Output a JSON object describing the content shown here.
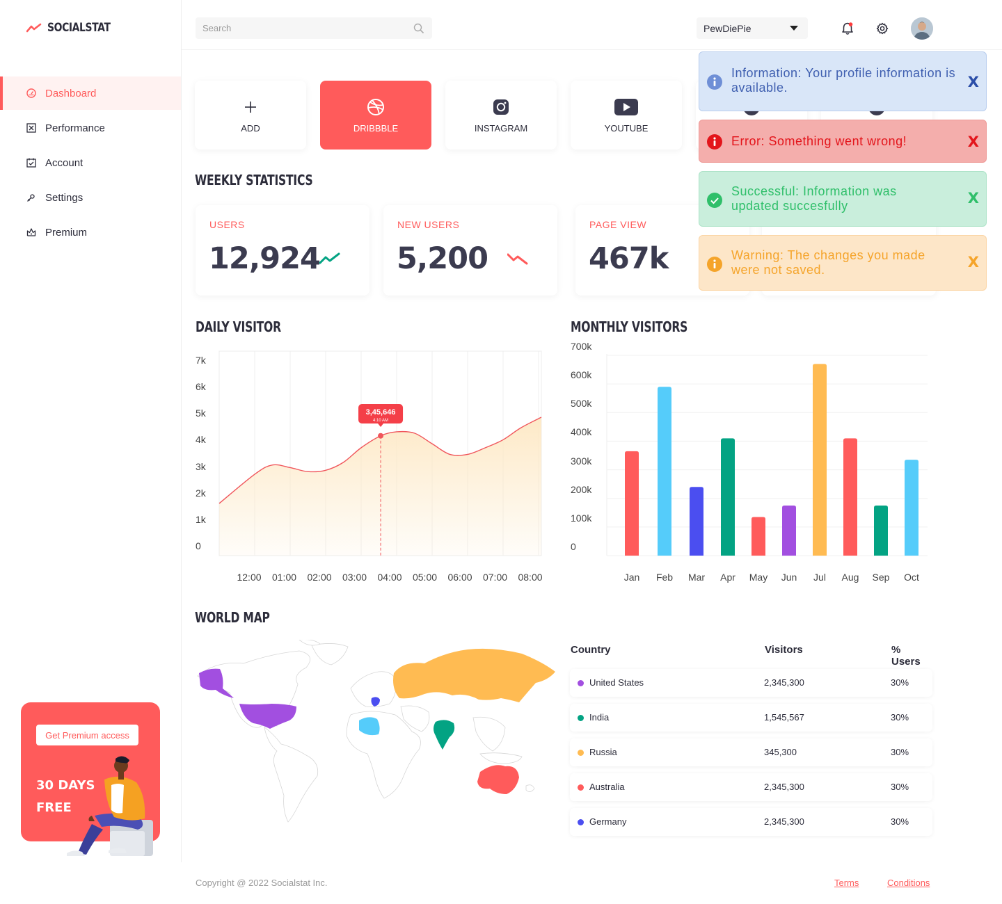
{
  "app": {
    "name": "SOCIALSTAT"
  },
  "sidebar": {
    "items": [
      {
        "label": "Dashboard",
        "icon": "dashboard-icon",
        "active": true
      },
      {
        "label": "Performance",
        "icon": "performance-icon"
      },
      {
        "label": "Account",
        "icon": "account-icon"
      },
      {
        "label": "Settings",
        "icon": "settings-icon"
      },
      {
        "label": "Premium",
        "icon": "premium-icon"
      }
    ],
    "premium": {
      "button_label": "Get Premium access",
      "title": "30 DAYS\nFREE"
    }
  },
  "header": {
    "search_placeholder": "Search",
    "account_selected": "PewDiePie"
  },
  "social": {
    "cards": [
      {
        "label": "ADD",
        "icon": "plus-icon"
      },
      {
        "label": "DRIBBBLE",
        "icon": "dribbble-icon",
        "active": true
      },
      {
        "label": "INSTAGRAM",
        "icon": "instagram-icon"
      },
      {
        "label": "YOUTUBE",
        "icon": "youtube-icon"
      }
    ]
  },
  "weekly": {
    "title": "WEEKLY STATISTICS",
    "stats": [
      {
        "label": "USERS",
        "value": "12,924",
        "trend": "up"
      },
      {
        "label": "NEW USERS",
        "value": "5,200",
        "trend": "down"
      },
      {
        "label": "PAGE VIEW",
        "value": "467k"
      }
    ]
  },
  "daily": {
    "title": "DAILY VISITOR",
    "tooltip": {
      "value": "3,45,646",
      "time": "4:10 AM"
    }
  },
  "monthly": {
    "title": "MONTHLY VISITORS"
  },
  "chart_data": [
    {
      "type": "area",
      "title": "DAILY VISITOR",
      "x": [
        "12:00",
        "01:00",
        "02:00",
        "03:00",
        "04:00",
        "05:00",
        "06:00",
        "07:00",
        "08:00"
      ],
      "y_ticks": [
        "0",
        "1k",
        "2k",
        "3k",
        "4k",
        "5k",
        "6k",
        "7k"
      ],
      "ylim": [
        0,
        7000
      ],
      "points": [
        {
          "t": -0.5,
          "v": 1600
        },
        {
          "t": 0,
          "v": 2700
        },
        {
          "t": 0.5,
          "v": 3050
        },
        {
          "t": 1,
          "v": 2950
        },
        {
          "t": 1.5,
          "v": 2800
        },
        {
          "t": 2,
          "v": 2850
        },
        {
          "t": 2.5,
          "v": 3150
        },
        {
          "t": 3,
          "v": 3700
        },
        {
          "t": 3.55,
          "v": 4150
        },
        {
          "t": 4,
          "v": 4300
        },
        {
          "t": 4.5,
          "v": 4250
        },
        {
          "t": 5,
          "v": 3850
        },
        {
          "t": 5.5,
          "v": 3450
        },
        {
          "t": 6,
          "v": 3450
        },
        {
          "t": 6.5,
          "v": 3700
        },
        {
          "t": 7,
          "v": 4000
        },
        {
          "t": 7.5,
          "v": 4450
        },
        {
          "t": 8,
          "v": 4850
        }
      ],
      "highlight": {
        "t": 3.55,
        "v": 4150
      },
      "colors": {
        "line": "#f0555b",
        "fill": "#fde8c4"
      }
    },
    {
      "type": "bar",
      "title": "MONTHLY VISITORS",
      "categories": [
        "Jan",
        "Feb",
        "Mar",
        "Apr",
        "May",
        "Jun",
        "Jul",
        "Aug",
        "Sep",
        "Oct"
      ],
      "values": [
        365000,
        590000,
        240000,
        410000,
        135000,
        175000,
        670000,
        410000,
        175000,
        335000
      ],
      "colors": [
        "#ff5b5b",
        "#55ccfa",
        "#4b4ef0",
        "#03a383",
        "#ff5b5b",
        "#a24fe0",
        "#ffbb52",
        "#ff5b5b",
        "#03a383",
        "#55ccfa"
      ],
      "y_ticks": [
        "0",
        "100k",
        "200k",
        "300k",
        "400k",
        "500k",
        "600k",
        "700k"
      ],
      "ylim": [
        0,
        700000
      ]
    }
  ],
  "world": {
    "title": "WORLD MAP",
    "table": {
      "headers": [
        "Country",
        "Visitors",
        "% Users"
      ],
      "rows": [
        {
          "country": "United States",
          "visitors": "2,345,300",
          "pct": "30%",
          "color": "#a24fe0"
        },
        {
          "country": "India",
          "visitors": "1,545,567",
          "pct": "30%",
          "color": "#03a383"
        },
        {
          "country": "Russia",
          "visitors": "345,300",
          "pct": "30%",
          "color": "#ffbb52"
        },
        {
          "country": "Australia",
          "visitors": "2,345,300",
          "pct": "30%",
          "color": "#ff5b5b"
        },
        {
          "country": "Germany",
          "visitors": "2,345,300",
          "pct": "30%",
          "color": "#4b4ef0"
        }
      ]
    }
  },
  "footer": {
    "copyright": "Copyright @ 2022 Socialstat Inc.",
    "terms": "Terms",
    "conditions": "Conditions"
  },
  "toasts": [
    {
      "type": "info",
      "text": "Information: Your profile information is available.",
      "close": "X",
      "bg": "#d9e6f8",
      "fg": "#3f5fb0"
    },
    {
      "type": "error",
      "text": "Error: Something went wrong!",
      "close": "X",
      "bg": "#f4aeac",
      "fg": "#e3151b"
    },
    {
      "type": "success",
      "text": "Successful: Information was updated succesfully",
      "close": "X",
      "bg": "#c9eedc",
      "fg": "#2fbf6a"
    },
    {
      "type": "warning",
      "text": "Warning: The changes you made were not saved.",
      "close": "X",
      "bg": "#fde6c8",
      "fg": "#f5a42a"
    }
  ]
}
